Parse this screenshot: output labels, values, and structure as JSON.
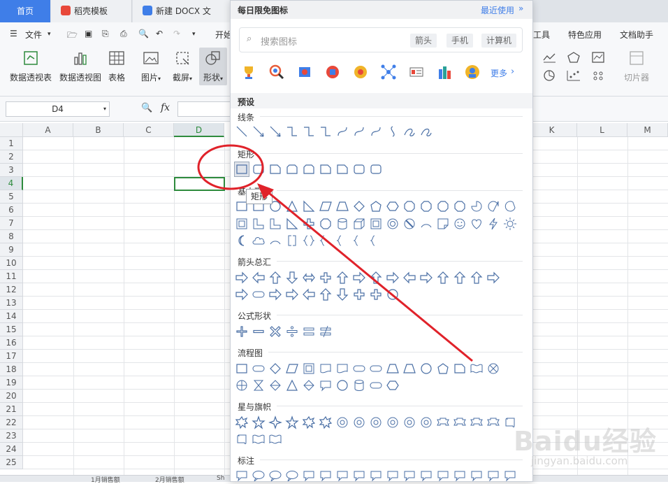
{
  "tabs": [
    {
      "label": "首页"
    },
    {
      "label": "稻壳模板"
    },
    {
      "label": "新建 DOCX 文档.do"
    }
  ],
  "menu": {
    "file": "文件",
    "start": "开始",
    "tools": "工具",
    "special": "特色应用",
    "doc_helper": "文档助手"
  },
  "ribbon": {
    "pivot_table": "数据透视表",
    "pivot_chart": "数据透视图",
    "table": "表格",
    "picture": "图片",
    "screenshot": "截屏",
    "shapes": "形状",
    "slicer": "切片器"
  },
  "formula_bar": {
    "cell_ref": "D4",
    "fx": "fx"
  },
  "columns": [
    "A",
    "B",
    "C",
    "D",
    "K",
    "L",
    "M"
  ],
  "rows": [
    "1",
    "2",
    "3",
    "4",
    "5",
    "6",
    "7",
    "8",
    "9",
    "10",
    "11",
    "12",
    "13",
    "14",
    "15",
    "16",
    "17",
    "18",
    "19",
    "20",
    "21",
    "22",
    "23",
    "24",
    "25"
  ],
  "sheets": [
    "1月销售额",
    "2月销售额",
    "Sh"
  ],
  "panel": {
    "title": "每日限免图标",
    "recent": "最近使用",
    "search_placeholder": "搜索图标",
    "chips": [
      "箭头",
      "手机",
      "计算机"
    ],
    "more": "更多",
    "preset": "预设",
    "sections": {
      "lines": "线条",
      "rect": "矩形",
      "basic": "基本形状",
      "arrows": "箭头总汇",
      "formula": "公式形状",
      "flowchart": "流程图",
      "stars": "星与旗帜",
      "callouts": "标注"
    }
  },
  "tooltip": "矩形",
  "watermark": {
    "logo": "Baidu经验",
    "url": "jingyan.baidu.com"
  },
  "colors": {
    "accent": "#3f7ee8",
    "annotation": "#e0222a",
    "selection": "#2e8b3d",
    "shape_stroke": "#4a6fa5"
  }
}
